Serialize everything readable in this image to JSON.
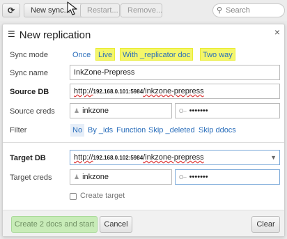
{
  "toolbar": {
    "refresh_icon": "refresh-icon",
    "new_label": "New sync...",
    "restart_label": "Restart...",
    "remove_label": "Remove...",
    "search_placeholder": "Search"
  },
  "dialog": {
    "title": "New replication",
    "close_label": "×",
    "sync_mode": {
      "label": "Sync mode",
      "options": [
        "Once",
        "Live",
        "With _replicator doc",
        "Two way"
      ]
    },
    "sync_name": {
      "label": "Sync name",
      "value": "InkZone-Prepress"
    },
    "source_db": {
      "label": "Source DB",
      "prefix": "http://",
      "host": "192.168.0.101:5984",
      "path": "/inkzone-prepress"
    },
    "source_creds": {
      "label": "Source creds",
      "user": "inkzone",
      "password": "•••••••"
    },
    "filter": {
      "label": "Filter",
      "options": [
        "No",
        "By _ids",
        "Function",
        "Skip _deleted",
        "Skip ddocs"
      ]
    },
    "target_db": {
      "label": "Target DB",
      "prefix": "http://",
      "host": "192.168.0.102:5984",
      "path": "/inkzone-prepress"
    },
    "target_creds": {
      "label": "Target creds",
      "user": "inkzone",
      "password": "•••••••"
    },
    "create_target_label": "Create target",
    "buttons": {
      "create": "Create 2 docs and start",
      "cancel": "Cancel",
      "clear": "Clear"
    }
  },
  "colors": {
    "highlight": "#f4f66a",
    "link": "#2a6ebb",
    "create_button": "#c8ecb8"
  }
}
